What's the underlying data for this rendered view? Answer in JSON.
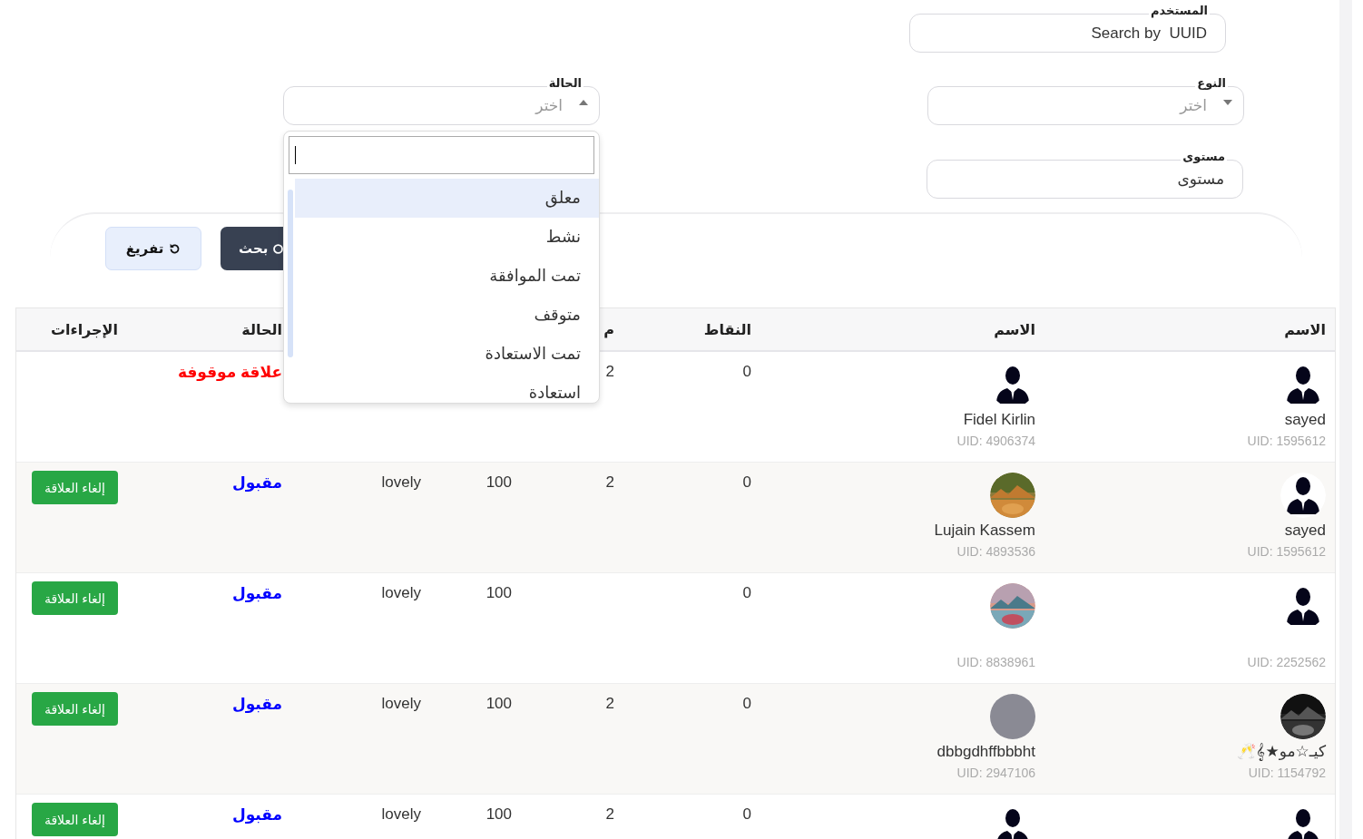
{
  "filters": {
    "user": {
      "label": "المستخدم",
      "kind": "text",
      "placeholder": "Search by  UUID"
    },
    "type": {
      "label": "النوع",
      "kind": "select",
      "placeholder": "اختر",
      "expanded": false
    },
    "status": {
      "label": "الحالة",
      "kind": "select",
      "placeholder": "اختر",
      "expanded": true
    },
    "level": {
      "label": "مستوى",
      "kind": "text",
      "placeholder": "مستوى"
    }
  },
  "buttons": {
    "clear": "تفريغ",
    "search": "بحث"
  },
  "status_dropdown": {
    "options": [
      {
        "label": "معلق",
        "selected": true
      },
      {
        "label": "نشط",
        "selected": false
      },
      {
        "label": "تمت الموافقة",
        "selected": false
      },
      {
        "label": "متوقف",
        "selected": false
      },
      {
        "label": "تمت الاستعادة",
        "selected": false
      },
      {
        "label": "استعادة",
        "selected": false
      }
    ]
  },
  "table": {
    "header": {
      "user": "الاسم",
      "partner": "الاسم",
      "points": "النقاط",
      "column_4": "م",
      "status": "الحالة",
      "actions": "الإجراءات"
    },
    "rows": [
      {
        "user": {
          "kind": "silhouette",
          "name": "sayed",
          "uid": "UID: 1595612"
        },
        "partner": {
          "kind": "silhouette",
          "name": "Fidel Kirlin",
          "uid": "UID: 4906374"
        },
        "points": "0",
        "column_4": "2",
        "status": {
          "text": "علاقة موقوفة",
          "color": "#ff0000"
        }
      },
      {
        "user": {
          "kind": "silhouette",
          "name": "sayed",
          "uid": "UID: 1595612"
        },
        "partner": {
          "name": "Lujain Kassem",
          "uid": "UID: 4893536"
        },
        "points": "0",
        "column_4": "2",
        "column_5": "100",
        "column_6": "lovely",
        "status": {
          "text": "مقبول",
          "color": "#0000ff"
        },
        "action": "إلغاء العلاقة"
      },
      {
        "user": {
          "kind": "silhouette",
          "uid": "UID: 2252562"
        },
        "partner": {
          "uid": "UID: 8838961"
        },
        "points": "0",
        "column_5": "100",
        "column_6": "lovely",
        "status": {
          "text": "مقبول",
          "color": "#0000ff"
        },
        "action": "إلغاء العلاقة"
      },
      {
        "user": {
          "name": "كيـ☆مو★𝄞🥂",
          "uid": "UID: 1154792"
        },
        "partner": {
          "kind": "plain",
          "name": "dbbgdhffbbbht",
          "uid": "UID: 2947106"
        },
        "points": "0",
        "column_4": "2",
        "column_5": "100",
        "column_6": "lovely",
        "status": {
          "text": "مقبول",
          "color": "#0000ff"
        },
        "action": "إلغاء العلاقة"
      },
      {
        "user": {
          "kind": "silhouette"
        },
        "partner": {
          "kind": "silhouette"
        },
        "points": "0",
        "column_4": "2",
        "column_5": "100",
        "column_6": "lovely",
        "status": {
          "text": "مقبول",
          "color": "#0000ff"
        },
        "action": "إلغاء العلاقة"
      }
    ]
  }
}
